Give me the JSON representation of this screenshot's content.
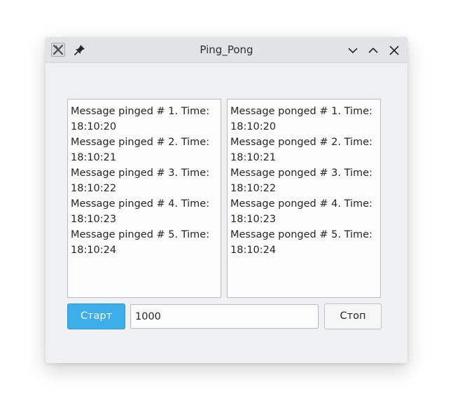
{
  "window": {
    "title": "Ping_Pong"
  },
  "icons": {
    "app": "x-logo-icon",
    "pin": "pin-icon",
    "minimize": "chevron-down-icon",
    "maximize": "chevron-up-icon",
    "close": "close-icon"
  },
  "ping_log": [
    {
      "text": "Message pinged # 1. Time: 18:10:20"
    },
    {
      "text": "Message pinged # 2. Time: 18:10:21"
    },
    {
      "text": "Message pinged # 3. Time: 18:10:22"
    },
    {
      "text": "Message pinged # 4. Time: 18:10:23"
    },
    {
      "text": "Message pinged # 5. Time: 18:10:24"
    }
  ],
  "pong_log": [
    {
      "text": "Message ponged # 1. Time: 18:10:20"
    },
    {
      "text": "Message ponged # 2. Time: 18:10:21"
    },
    {
      "text": "Message ponged # 3. Time: 18:10:22"
    },
    {
      "text": "Message ponged # 4. Time: 18:10:23"
    },
    {
      "text": "Message ponged # 5. Time: 18:10:24"
    }
  ],
  "controls": {
    "start_label": "Старт",
    "interval_value": "1000",
    "stop_label": "Стоп"
  },
  "colors": {
    "accent": "#3daee9",
    "window_bg": "#eff0f2",
    "titlebar_bg": "#e2e3e6"
  }
}
